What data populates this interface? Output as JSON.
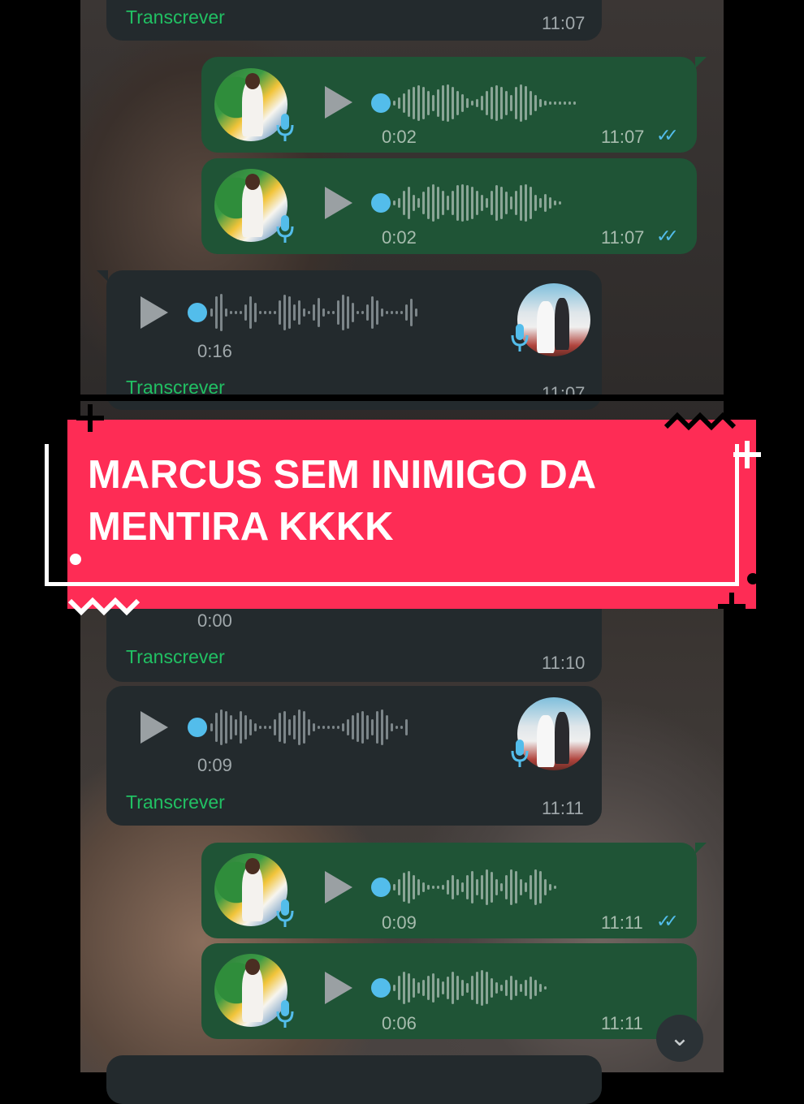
{
  "messages": [
    {
      "transcribe_label": "Transcrever",
      "time": "11:07"
    },
    {
      "duration": "0:02",
      "time": "11:07"
    },
    {
      "duration": "0:02",
      "time": "11:07"
    },
    {
      "duration": "0:16",
      "transcribe_label": "Transcrever",
      "time": "11:07"
    },
    {
      "duration": "0:00",
      "transcribe_label": "Transcrever",
      "time": "11:10"
    },
    {
      "duration": "0:09",
      "transcribe_label": "Transcrever",
      "time": "11:11"
    },
    {
      "duration": "0:09",
      "time": "11:11"
    },
    {
      "duration": "0:06",
      "time": "11:11"
    }
  ],
  "overlay": {
    "line1": "MARCUS SEM INIMIGO DA",
    "line2": "MENTIRA KKKK",
    "color": "#fe2c55"
  },
  "colors": {
    "outgoing_bubble": "#1f5436",
    "incoming_bubble": "#232a2d",
    "accent_blue": "#53bdeb",
    "transcribe_green": "#21c063"
  },
  "icons": {
    "play": "play-icon",
    "mic": "mic-icon",
    "read_receipt": "double-check-icon",
    "scroll_down": "chevron-double-down-icon"
  }
}
